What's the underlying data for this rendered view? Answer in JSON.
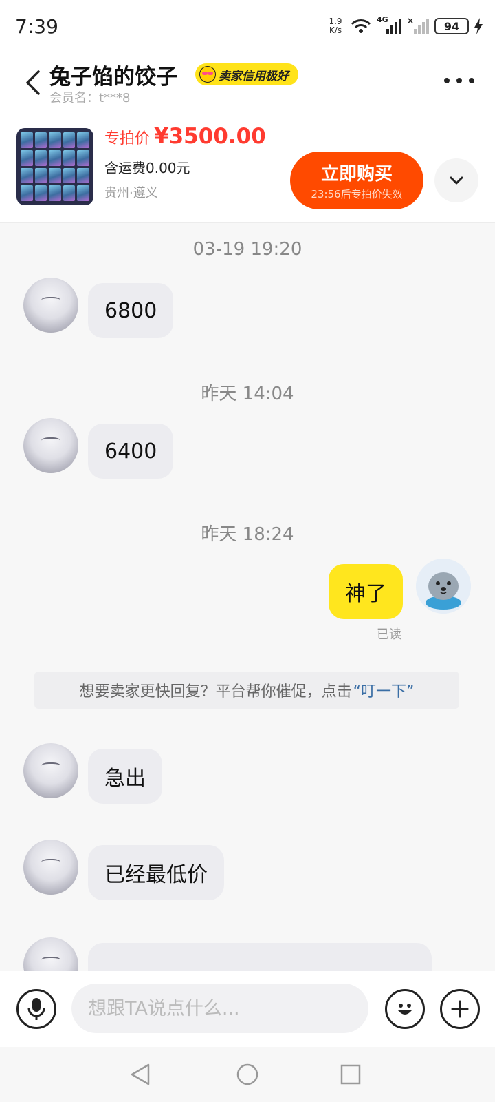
{
  "status_bar": {
    "time": "7:39",
    "net_speed_value": "1.9",
    "net_speed_unit": "K/s",
    "network": "4G",
    "battery": "94"
  },
  "header": {
    "seller_name": "兔子馅的饺子",
    "credit_badge": "卖家信用极好",
    "member_label": "会员名：",
    "member_id": "t***8"
  },
  "product": {
    "price_label": "专拍价",
    "price": "¥3500.00",
    "shipping": "含运费0.00元",
    "location": "贵州·遵义",
    "buy_label": "立即购买",
    "buy_countdown": "23:56后专拍价失效"
  },
  "chat": {
    "messages": [
      {
        "timestamp": "03-19 19:20",
        "from": "seller",
        "text": "6800"
      },
      {
        "timestamp": "昨天 14:04",
        "from": "seller",
        "text": "6400"
      },
      {
        "timestamp": "昨天 18:24",
        "from": "me",
        "text": "神了",
        "status": "已读"
      },
      {
        "from": "seller",
        "text": "急出"
      },
      {
        "from": "seller",
        "text": "已经最低价"
      }
    ],
    "hint_text": "想要卖家更快回复？平台帮你催促，点击",
    "hint_link": "“叮一下”"
  },
  "input": {
    "placeholder": "想跟TA说点什么..."
  },
  "colors": {
    "accent_orange": "#ff4a00",
    "price_red": "#ff3b30",
    "my_bubble_yellow": "#ffe61e",
    "link_blue": "#3a6ea5"
  },
  "icons": [
    "back-icon",
    "more-icon",
    "chevron-down-icon",
    "mic-icon",
    "emoji-icon",
    "plus-icon",
    "nav-back-icon",
    "nav-home-icon",
    "nav-recents-icon"
  ]
}
